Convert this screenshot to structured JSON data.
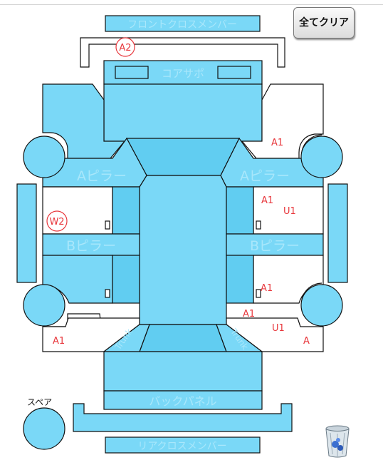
{
  "toolbar": {
    "clear_all_label": "全てクリア"
  },
  "parts": {
    "front_cross_member": "フロントクロスメンバー",
    "core_support": "コアサポ",
    "a_pillar_left": "Aピラー",
    "a_pillar_right": "Aピラー",
    "b_pillar_left": "Bピラー",
    "b_pillar_right": "Bピラー",
    "trunk_left": "Trunk",
    "trunk_right": "Trunk",
    "back_panel": "バックパネル",
    "rear_cross_member": "リアクロスメンバー"
  },
  "spare": {
    "label": "スペア"
  },
  "damage_marks": [
    {
      "id": "a2-front",
      "text": "A2",
      "circled": true
    },
    {
      "id": "a1-front-right",
      "text": "A1"
    },
    {
      "id": "a1-right-front-door",
      "text": "A1"
    },
    {
      "id": "u1-right-front-door",
      "text": "U1"
    },
    {
      "id": "w2-left-front-door",
      "text": "W2",
      "circled": true
    },
    {
      "id": "a1-right-rear-door",
      "text": "A1"
    },
    {
      "id": "a1-rear-right-quarter",
      "text": "A1"
    },
    {
      "id": "u1-rear-right-quarter",
      "text": "U1"
    },
    {
      "id": "a-rear-right",
      "text": "A"
    },
    {
      "id": "a1-rear-left",
      "text": "A1"
    }
  ],
  "icons": {
    "trash": "trash-icon"
  },
  "colors": {
    "panel": "#7ad8f7",
    "panel_dark": "#61cdf1",
    "mark": "#e8383d"
  }
}
